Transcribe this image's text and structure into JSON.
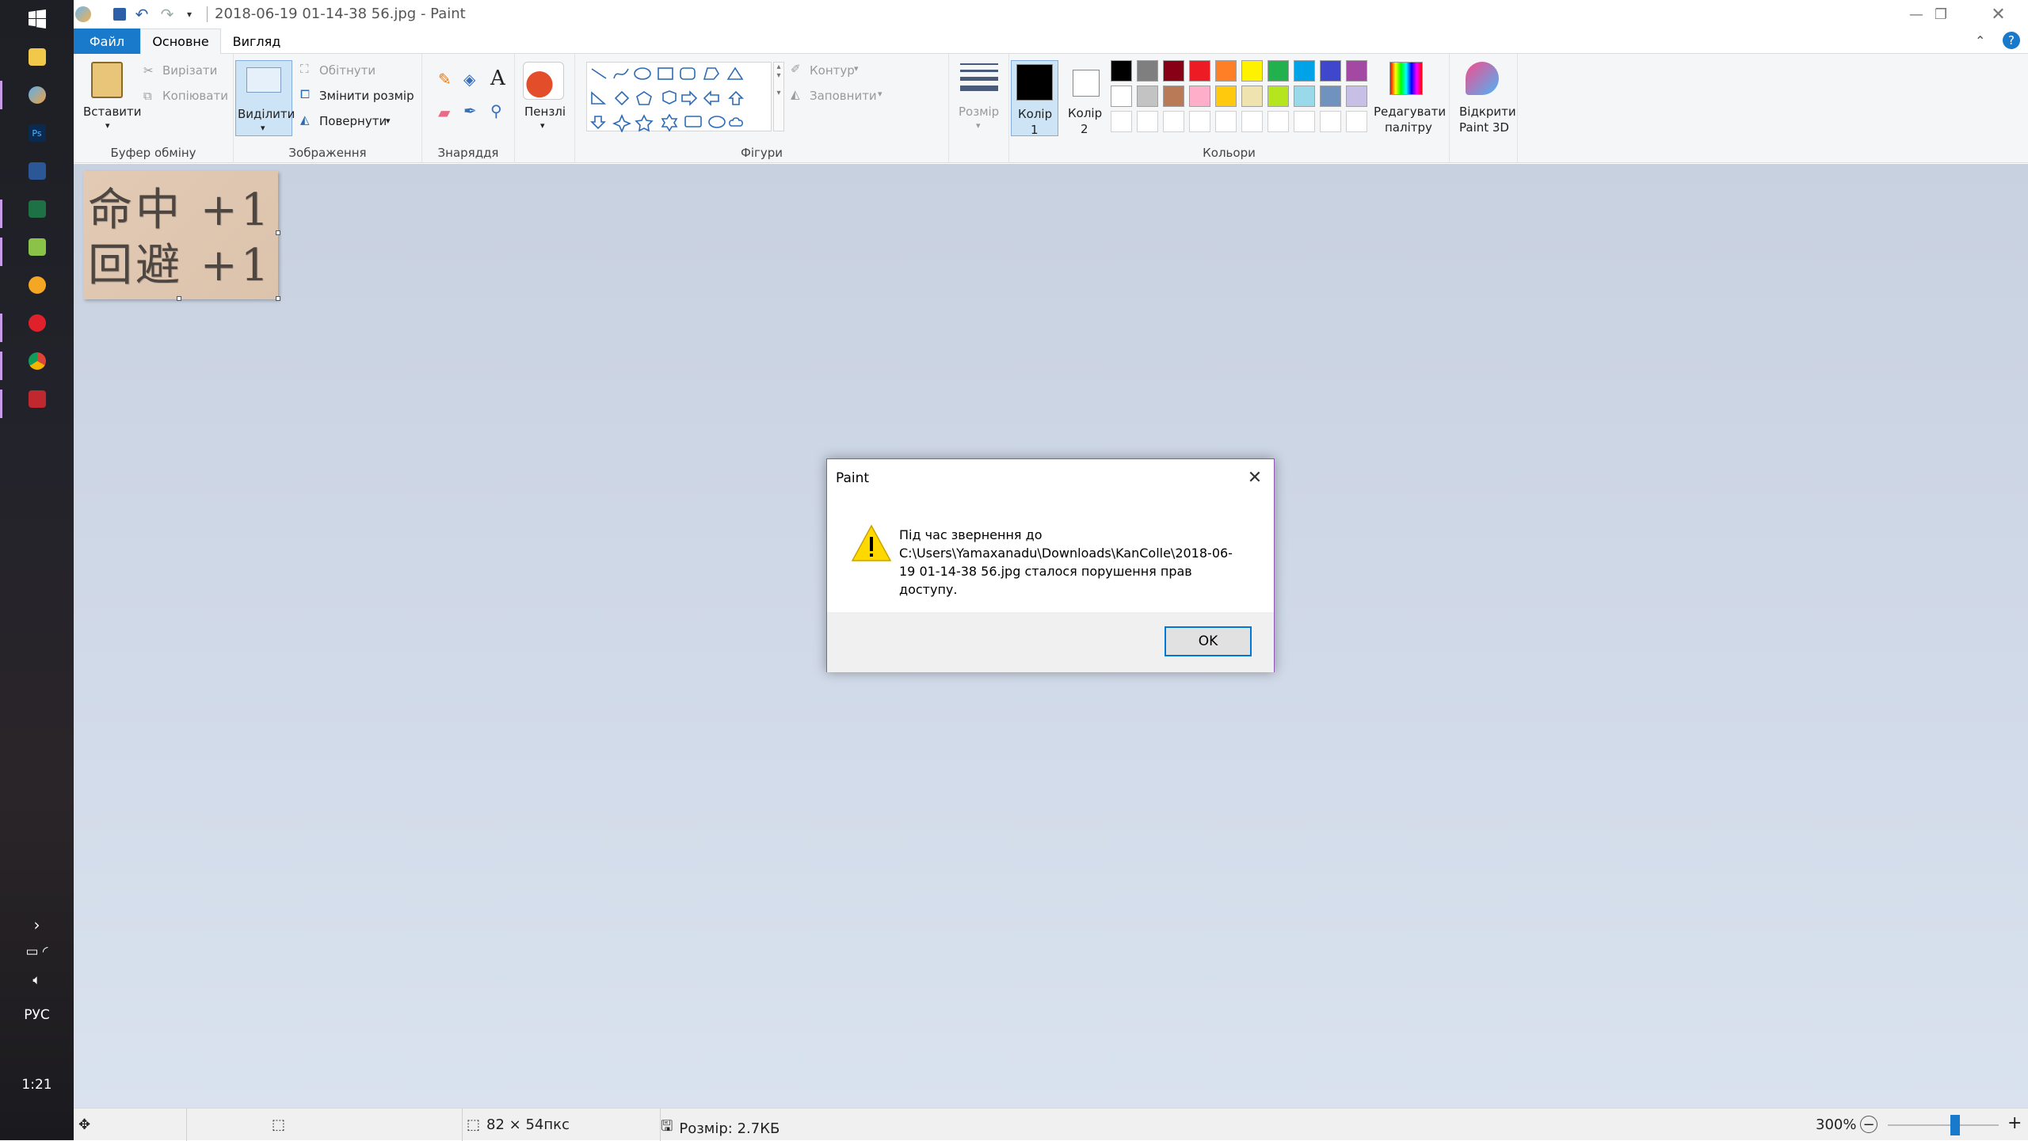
{
  "window": {
    "title": "2018-06-19 01-14-38 56.jpg - Paint"
  },
  "tabs": {
    "file": "Файл",
    "home": "Основне",
    "view": "Вигляд"
  },
  "clipboard": {
    "paste": "Вставити",
    "cut": "Вирізати",
    "copy": "Копіювати",
    "label": "Буфер обміну"
  },
  "image_group": {
    "select": "Виділити",
    "crop": "Обітнути",
    "resize": "Змінити розмір",
    "rotate": "Повернути",
    "label": "Зображення"
  },
  "tools": {
    "label": "Знаряддя"
  },
  "brushes": {
    "label": "Пензлі"
  },
  "shapes": {
    "outline": "Контур",
    "fill": "Заповнити",
    "label": "Фігури"
  },
  "size": {
    "label": "Розмір"
  },
  "colors": {
    "color1": "Колір\n1",
    "color1_a": "Колір",
    "color1_b": "1",
    "color2_a": "Колір",
    "color2_b": "2",
    "edit_a": "Редагувати",
    "edit_b": "палітру",
    "paint3d_a": "Відкрити",
    "paint3d_b": "Paint 3D",
    "label": "Кольори",
    "row1": [
      "#000000",
      "#7f7f7f",
      "#880015",
      "#ed1c24",
      "#ff7f27",
      "#fff200",
      "#22b14c",
      "#00a2e8",
      "#3f48cc",
      "#a349a4"
    ],
    "row2": [
      "#ffffff",
      "#c3c3c3",
      "#b97a57",
      "#ffaec9",
      "#ffc90e",
      "#efe4b0",
      "#b5e61d",
      "#99d9ea",
      "#7092be",
      "#c8bfe7"
    ]
  },
  "canvas_image": {
    "line1": "命中 +1",
    "line2": "回避 +1"
  },
  "status": {
    "dimensions": "82 × 54пкс",
    "filesize": "Розмір: 2.7КБ",
    "zoom": "300%"
  },
  "dialog": {
    "title": "Paint",
    "message": "Під час звернення до C:\\Users\\Yamaxanadu\\Downloads\\KanColle\\2018-06-19 01-14-38 56.jpg сталося порушення прав доступу.",
    "ok": "OK"
  },
  "taskbar": {
    "time": "1:21",
    "lang": "РУС"
  }
}
